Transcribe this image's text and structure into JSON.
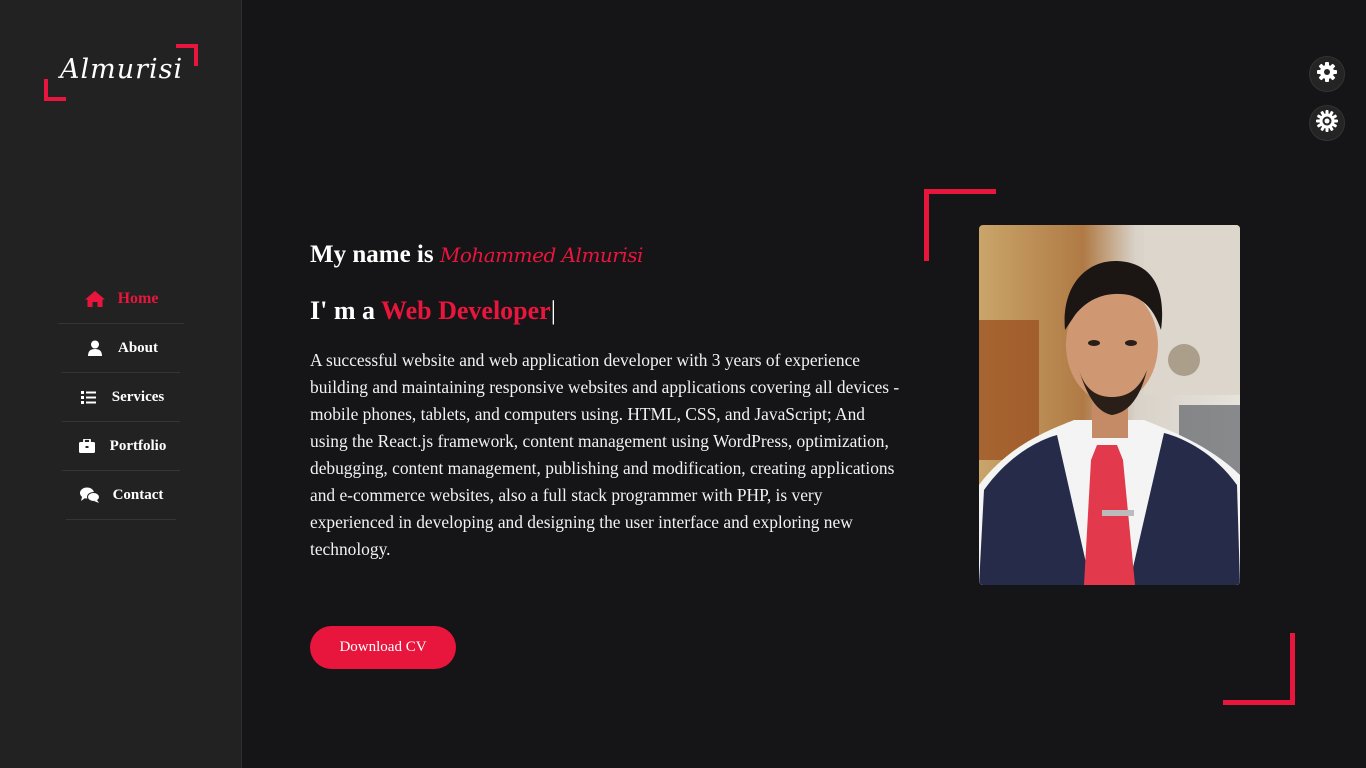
{
  "brand": {
    "logo_text": "Almurisi"
  },
  "nav": {
    "items": [
      {
        "label": "Home",
        "icon": "home-icon",
        "active": true
      },
      {
        "label": "About",
        "icon": "user-icon",
        "active": false
      },
      {
        "label": "Services",
        "icon": "list-icon",
        "active": false
      },
      {
        "label": "Portfolio",
        "icon": "briefcase-icon",
        "active": false
      },
      {
        "label": "Contact",
        "icon": "chat-bubbles-icon",
        "active": false
      }
    ]
  },
  "hero": {
    "greeting_prefix": "My name is",
    "name": "Mohammed Almurisi",
    "role_prefix": "I' m a",
    "role": "Web Developer",
    "cursor": "|",
    "bio": "A successful website and web application developer with 3 years of experience building and maintaining responsive websites and applications covering all devices - mobile phones, tablets, and computers using. HTML, CSS, and JavaScript; And using the React.js framework, content management using WordPress, optimization, debugging, content management, publishing and modification, creating applications and e-commerce websites, also a full stack programmer with PHP, is very experienced in developing and designing the user interface and exploring new technology.",
    "cv_button": "Download CV"
  },
  "controls": {
    "settings_icon": "gear-icon",
    "theme_icon": "sun-gear-icon"
  },
  "colors": {
    "accent": "#e8153c",
    "background": "#151416",
    "sidebar": "#222222"
  }
}
